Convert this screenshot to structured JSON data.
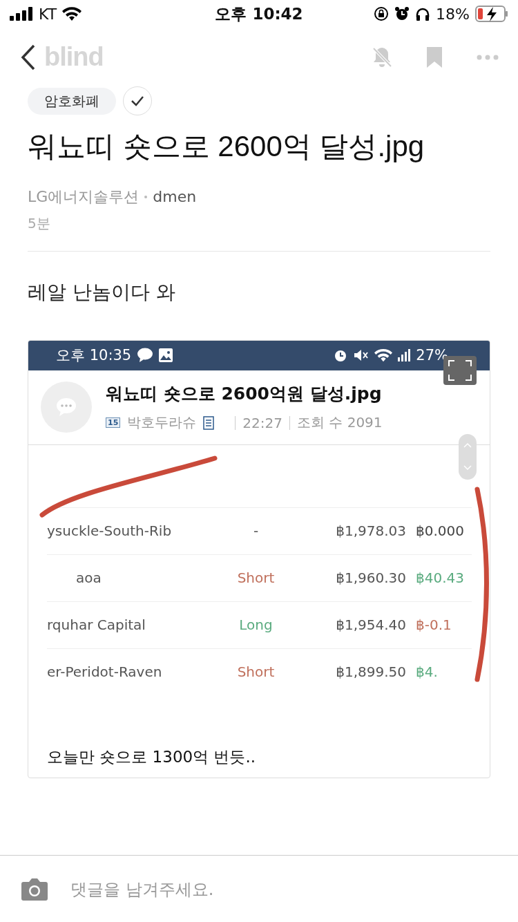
{
  "status_bar": {
    "carrier": "KT",
    "time": "오후 10:42",
    "battery": "18%"
  },
  "nav": {
    "logo": "blind"
  },
  "post": {
    "category": "암호화폐",
    "title": "워뇨띠 숏으로 2600억 달성.jpg",
    "company": "LG에너지솔루션",
    "author": "dmen",
    "time": "5분",
    "body": "레알 난놈이다 와"
  },
  "screenshot": {
    "status_bar": {
      "time": "오후 10:35",
      "battery": "27%"
    },
    "post": {
      "title": "워뇨띠 숏으로 2600억원 달성.jpg",
      "badge": "15",
      "author": "박호두라슈",
      "time": "22:27",
      "views": "조회 수 2091"
    },
    "rows": [
      {
        "name": "ysuckle-South-Rib",
        "side": {
          "text": "-",
          "color": "#555555"
        },
        "price": "฿1,978.03",
        "pnl": {
          "text": "฿0.000",
          "color": "#444444"
        }
      },
      {
        "name": "aoa",
        "side": {
          "text": "Short",
          "color": "#c0705c"
        },
        "price": "฿1,960.30",
        "pnl": {
          "text": "฿40.43",
          "color": "#5aab7f"
        }
      },
      {
        "name": "rquhar Capital",
        "side": {
          "text": "Long",
          "color": "#5aab7f"
        },
        "price": "฿1,954.40",
        "pnl": {
          "text": "฿-0.1",
          "color": "#c0705c"
        }
      },
      {
        "name": "er-Peridot-Raven",
        "side": {
          "text": "Short",
          "color": "#c0705c"
        },
        "price": "฿1,899.50",
        "pnl": {
          "text": "฿4.",
          "color": "#5aab7f"
        }
      }
    ],
    "caption": "오늘만 숏으로 1300억 번듯.."
  },
  "comment": {
    "placeholder": "댓글을 남겨주세요."
  }
}
